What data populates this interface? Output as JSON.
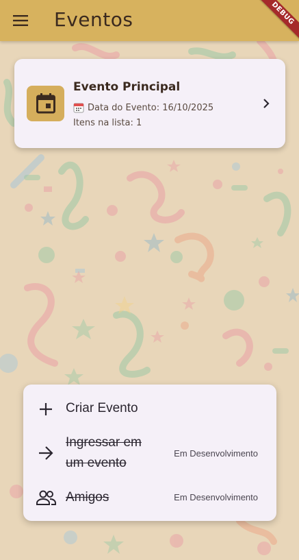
{
  "app_bar": {
    "title": "Eventos",
    "menu_icon": "menu-icon",
    "debug_banner": "DEBUG",
    "color": "#d7b25e"
  },
  "event_card": {
    "name": "Evento Principal",
    "date_text": "Data do Evento: 16/10/2025",
    "items_text": "Itens na lista: 1",
    "icon": "calendar-icon",
    "accent_color": "#d5ae5c"
  },
  "actions": {
    "items": [
      {
        "label": "Criar Evento",
        "icon": "plus-icon",
        "status": "",
        "disabled": false
      },
      {
        "label": "Ingressar em um evento",
        "icon": "arrow-right-icon",
        "status": "Em Desenvolvimento",
        "disabled": true
      },
      {
        "label": "Amigos",
        "icon": "people-icon",
        "status": "Em Desenvolvimento",
        "disabled": true
      }
    ]
  }
}
